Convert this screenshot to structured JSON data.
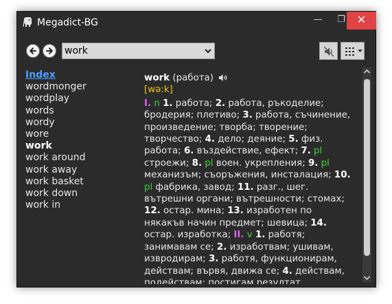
{
  "window": {
    "title": "Megadict-BG",
    "min_glyph": "—",
    "max_glyph": "❐",
    "close_glyph": "✕"
  },
  "toolbar": {
    "search_value": "work",
    "back_icon": "arrow-left-circle-icon",
    "forward_icon": "arrow-right-circle-icon",
    "sound_icon": "speaker-mute-icon",
    "menu_icon": "grid-menu-icon"
  },
  "word_list": {
    "index_label": "Index",
    "items": [
      "wordmonger",
      "wordplay",
      "words",
      "wordy",
      "wore",
      "work",
      "work around",
      "work away",
      "work basket",
      "work down",
      "work in"
    ],
    "selected": "work"
  },
  "entry": {
    "headword": "work",
    "head_translation": "(работа)",
    "transcription": "[wə:k]",
    "definition_segments": [
      {
        "t": "I.",
        "c": "rn"
      },
      {
        "t": " "
      },
      {
        "t": "n",
        "c": "pos"
      },
      {
        "t": " "
      },
      {
        "t": "1.",
        "c": "num"
      },
      {
        "t": " работа; "
      },
      {
        "t": "2.",
        "c": "num"
      },
      {
        "t": " работа, ръкоделие; бродерия; плетиво; "
      },
      {
        "t": "3.",
        "c": "num"
      },
      {
        "t": " работа, съчинение, произведение; творба; творение; творчество; "
      },
      {
        "t": "4.",
        "c": "num"
      },
      {
        "t": " дело; деяние; "
      },
      {
        "t": "5.",
        "c": "num"
      },
      {
        "t": " физ. работа; "
      },
      {
        "t": "6.",
        "c": "num"
      },
      {
        "t": " въздействие, ефект; "
      },
      {
        "t": "7.",
        "c": "num"
      },
      {
        "t": " "
      },
      {
        "t": "pl",
        "c": "pos"
      },
      {
        "t": " строежи; "
      },
      {
        "t": "8.",
        "c": "num"
      },
      {
        "t": " "
      },
      {
        "t": "pl",
        "c": "pos"
      },
      {
        "t": " воен. укрепления; "
      },
      {
        "t": "9.",
        "c": "num"
      },
      {
        "t": " "
      },
      {
        "t": "pl",
        "c": "pos"
      },
      {
        "t": " механизъм; съоръжения, инсталация; "
      },
      {
        "t": "10.",
        "c": "num"
      },
      {
        "t": " "
      },
      {
        "t": "pl",
        "c": "pos"
      },
      {
        "t": " фабрика, завод; "
      },
      {
        "t": "11.",
        "c": "num"
      },
      {
        "t": " разг., шег. вътрешни органи; вътрешности; стомах; "
      },
      {
        "t": "12.",
        "c": "num"
      },
      {
        "t": " остар. мина; "
      },
      {
        "t": "13.",
        "c": "num"
      },
      {
        "t": " изработен по някакъв начин предмет; шевица; "
      },
      {
        "t": "14.",
        "c": "num"
      },
      {
        "t": " остар. изработка; "
      },
      {
        "t": "II.",
        "c": "rn"
      },
      {
        "t": " "
      },
      {
        "t": "v",
        "c": "pos"
      },
      {
        "t": " "
      },
      {
        "t": "1.",
        "c": "num"
      },
      {
        "t": " работя; занимавам се; "
      },
      {
        "t": "2.",
        "c": "num"
      },
      {
        "t": " изработвам; ушивам, извродирам; "
      },
      {
        "t": "3.",
        "c": "num"
      },
      {
        "t": " работя, функционирам, действам; вървя, движа се; "
      },
      {
        "t": "4.",
        "c": "num"
      },
      {
        "t": " действам, подействам; постигам резултат"
      }
    ]
  },
  "colors": {
    "background": "#2b2b2b",
    "link": "#4a9eff",
    "roman_numeral": "#e15cf2",
    "part_of_speech": "#3fd13f",
    "transcription": "#f0c419",
    "close_button": "#e04343"
  }
}
